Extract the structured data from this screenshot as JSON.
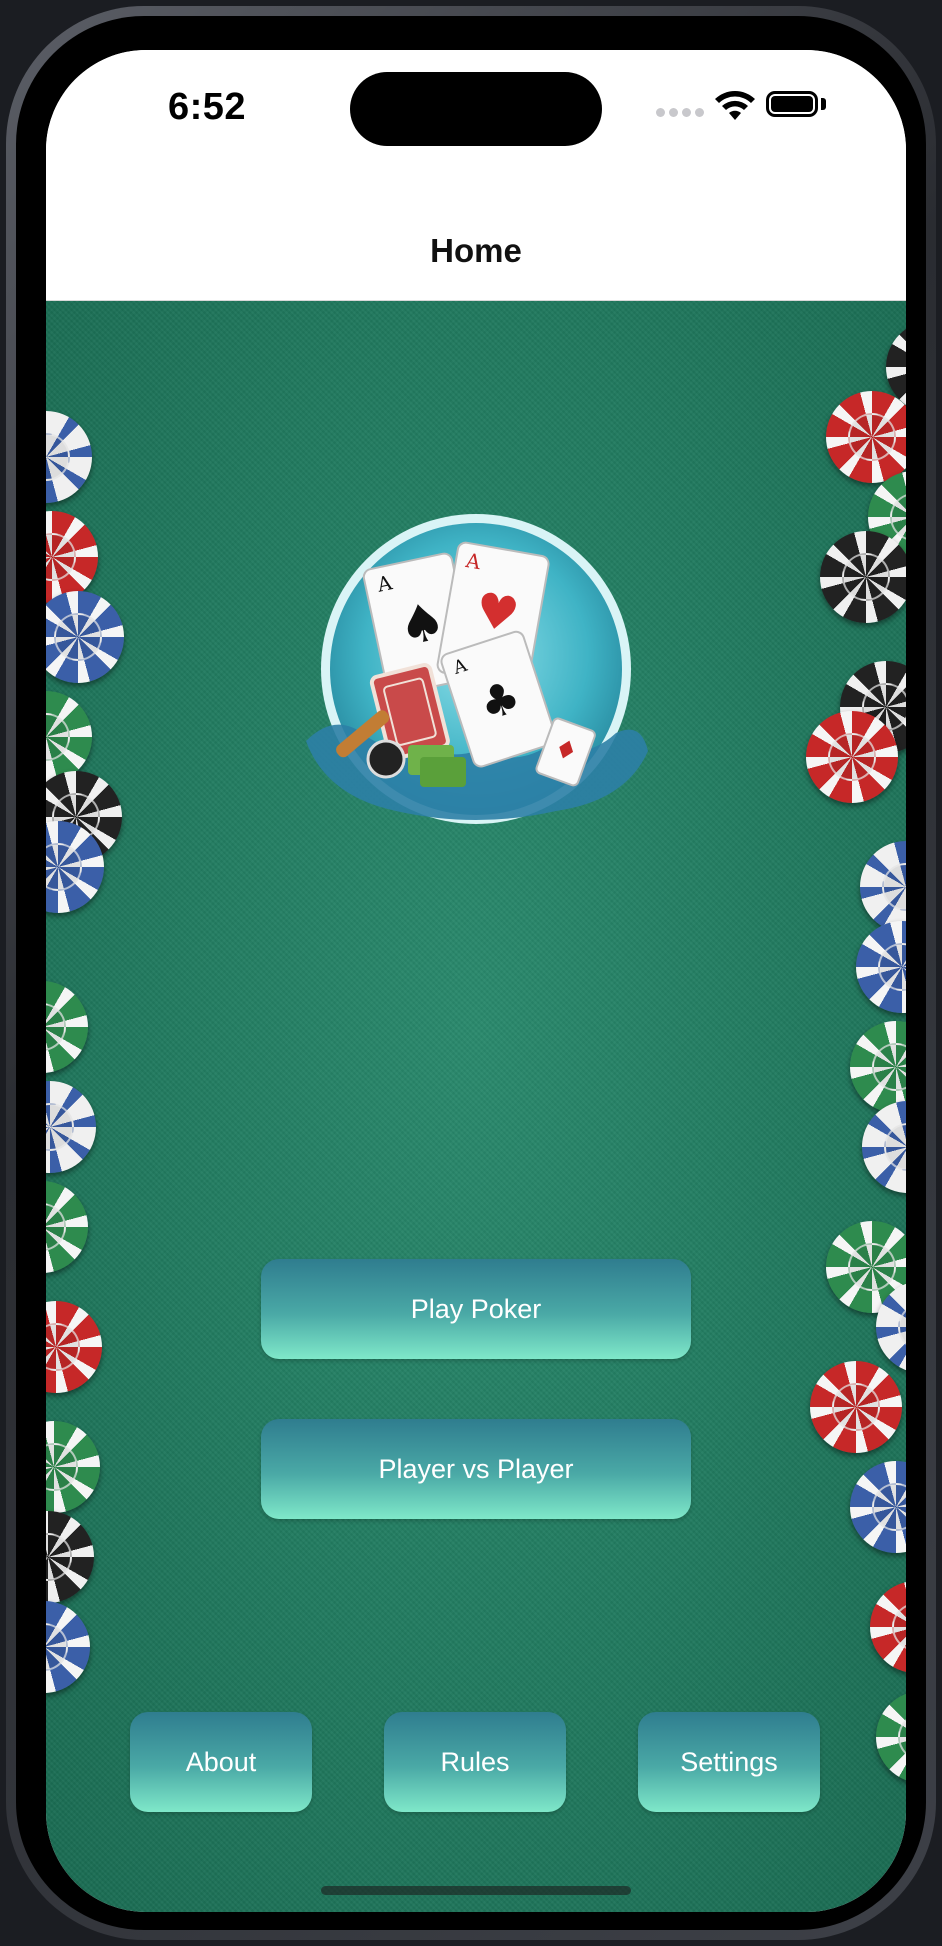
{
  "status_bar": {
    "time": "6:52"
  },
  "nav": {
    "title": "Home"
  },
  "main": {
    "logo_icon": "poker-cards-splash-logo",
    "primary_buttons": {
      "play_poker": "Play Poker",
      "player_vs_player": "Player vs Player"
    },
    "bottom_buttons": {
      "about": "About",
      "rules": "Rules",
      "settings": "Settings"
    }
  },
  "colors": {
    "felt": "#217a5f",
    "button_top": "#2f7d8f",
    "button_bottom": "#7fe8c9"
  }
}
